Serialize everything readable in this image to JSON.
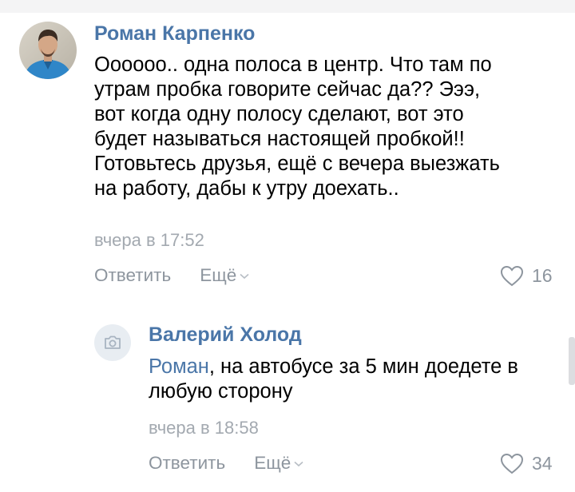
{
  "comments": [
    {
      "author": "Роман Карпенко",
      "text_lines": [
        "Оооооо.. одна полоса в центр. Что там по",
        "утрам пробка говорите сейчас да?? Эээ,",
        "вот когда одну полосу сделают, вот это",
        "будет называться настоящей пробкой!!",
        "Готовьтесь друзья, ещё с вечера выезжать",
        "на работу, дабы к утру доехать.."
      ],
      "time": "вчера в 17:52",
      "reply_label": "Ответить",
      "more_label": "Ещё",
      "likes": "16",
      "avatar_icon": "user-photo-avatar"
    },
    {
      "author": "Валерий Холод",
      "mention": "Роман",
      "text_rest": ", на автобусе за 5 мин доедете в",
      "text_line2": "любую сторону",
      "time": "вчера в 18:58",
      "reply_label": "Ответить",
      "more_label": "Ещё",
      "likes": "34",
      "avatar_icon": "camera-placeholder-icon"
    }
  ],
  "colors": {
    "link": "#4a76a8",
    "meta": "#a3a9b0",
    "action": "#8d959e",
    "avatar_placeholder": "#e8edf2"
  }
}
